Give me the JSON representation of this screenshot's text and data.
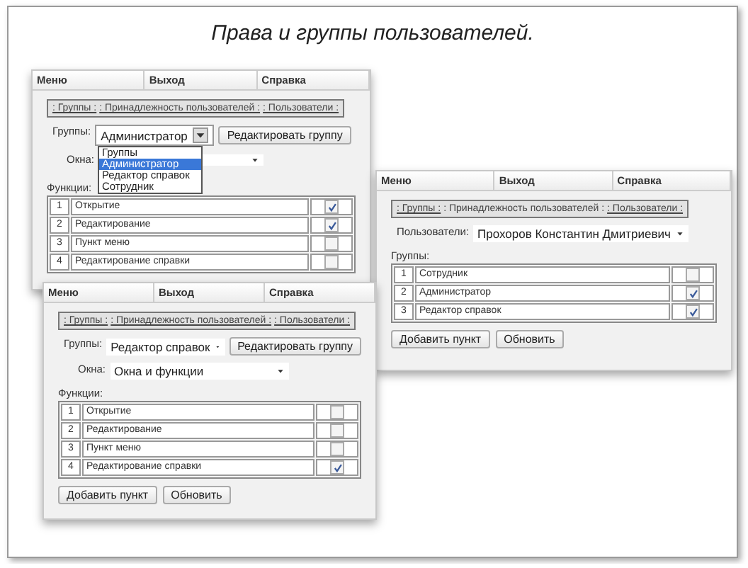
{
  "title": "Права и группы пользователей.",
  "windows": [
    {
      "menu": [
        "Меню",
        "Выход",
        "Справка"
      ],
      "nav": [
        {
          "label": ": Группы :",
          "selected": false
        },
        {
          "label": ": Принадлежность пользователей :",
          "selected": false
        },
        {
          "label": ": Пользователи :",
          "selected": false
        }
      ],
      "selectors": [
        {
          "label": "Группы:",
          "value": "Администратор",
          "button": "Редактировать группу",
          "options": [
            {
              "label": "Группы",
              "selected": false
            },
            {
              "label": "Администратор",
              "selected": true
            },
            {
              "label": "Редактор справок",
              "selected": false
            },
            {
              "label": "Сотрудник",
              "selected": false
            }
          ]
        },
        {
          "label": "Окна:"
        }
      ],
      "list": {
        "label": "Функции:",
        "rows": [
          {
            "number": "1",
            "label": "Открытие",
            "checked": true
          },
          {
            "number": "2",
            "label": "Редактирование",
            "checked": true
          },
          {
            "number": "3",
            "label": "Пункт меню",
            "checked": false
          },
          {
            "number": "4",
            "label": "Редактирование справки",
            "checked": false
          }
        ]
      }
    },
    {
      "menu": [
        "Меню",
        "Выход",
        "Справка"
      ],
      "nav": [
        {
          "label": ": Группы :",
          "selected": false
        },
        {
          "label": ": Принадлежность пользователей :",
          "selected": true
        },
        {
          "label": ": Пользователи :",
          "selected": false
        }
      ],
      "selectors": [
        {
          "label": "Пользователи:",
          "value": "Прохоров Константин Дмитриевич"
        }
      ],
      "list": {
        "label": "Группы:",
        "rows": [
          {
            "number": "1",
            "label": "Сотрудник",
            "checked": false
          },
          {
            "number": "2",
            "label": "Администратор",
            "checked": true
          },
          {
            "number": "3",
            "label": "Редактор справок",
            "checked": true
          }
        ]
      },
      "buttons": [
        "Добавить пункт",
        "Обновить"
      ]
    },
    {
      "menu": [
        "Меню",
        "Выход",
        "Справка"
      ],
      "nav": [
        {
          "label": ": Группы :",
          "selected": false
        },
        {
          "label": ": Принадлежность пользователей :",
          "selected": false
        },
        {
          "label": ": Пользователи :",
          "selected": false
        }
      ],
      "selectors": [
        {
          "label": "Группы:",
          "value": "Редактор справок",
          "button": "Редактировать группу"
        },
        {
          "label": "Окна:",
          "value": "Окна и функции"
        }
      ],
      "list": {
        "label": "Функции:",
        "rows": [
          {
            "number": "1",
            "label": "Открытие",
            "checked": false
          },
          {
            "number": "2",
            "label": "Редактирование",
            "checked": false
          },
          {
            "number": "3",
            "label": "Пункт меню",
            "checked": false
          },
          {
            "number": "4",
            "label": "Редактирование справки",
            "checked": true
          }
        ]
      },
      "buttons": [
        "Добавить пункт",
        "Обновить"
      ]
    }
  ]
}
